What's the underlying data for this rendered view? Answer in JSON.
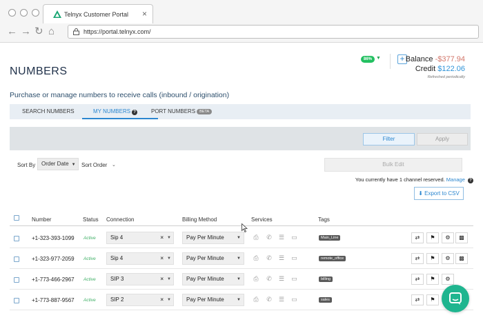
{
  "browser": {
    "tab_title": "Telnyx Customer Portal",
    "tab_close": "×",
    "url": "https://portal.telnyx.com/",
    "nav_icons": [
      "back-arrow-icon",
      "forward-arrow-icon",
      "reload-icon",
      "home-icon",
      "lock-icon"
    ]
  },
  "header": {
    "page_title": "NUMBERS",
    "percent_badge": "86%",
    "plus_label": "+",
    "balance_label": "Balance",
    "balance_value": "-$377.94",
    "credit_label": "Credit",
    "credit_value": "$122.06",
    "refreshed_note": "Refreshed periodically",
    "subtitle": "Purchase or manage numbers to receive calls (inbound / origination)"
  },
  "tabs": [
    {
      "label": "SEARCH NUMBERS",
      "active": false
    },
    {
      "label": "MY NUMBERS",
      "active": true,
      "help": "?"
    },
    {
      "label": "PORT NUMBERS",
      "active": false,
      "badge": "BETA"
    }
  ],
  "filter_panel": {
    "filter_label": "Filter",
    "apply_label": "Apply"
  },
  "controls": {
    "sort_by_label": "Sort By",
    "sort_by_value": "Order Date",
    "sort_order_label": "Sort Order",
    "bulk_edit_label": "Bulk Edit",
    "reserved_text": "You currently have 1 channel reserved.",
    "reserved_link": "Manage",
    "reserved_help": "?",
    "export_label": "Export to CSV"
  },
  "table": {
    "columns": [
      "Number",
      "Status",
      "Connection",
      "Billing Method",
      "Services",
      "Tags"
    ],
    "service_icons": [
      "fax-icon",
      "phone-icon",
      "database-icon",
      "id-card-icon"
    ],
    "action_icons": [
      "transfer-icon",
      "tag-icon",
      "gear-icon",
      "trash-icon"
    ],
    "rows": [
      {
        "number": "+1-323-393-1099",
        "status": "Active",
        "connection": "Sip 4",
        "billing": "Pay Per Minute",
        "tag": "Main_Line"
      },
      {
        "number": "+1-323-977-2059",
        "status": "Active",
        "connection": "Sip 4",
        "billing": "Pay Per Minute",
        "tag": "remote_office"
      },
      {
        "number": "+1-773-466-2967",
        "status": "Active",
        "connection": "SIP 3",
        "billing": "Pay Per Minute",
        "tag": "billing"
      },
      {
        "number": "+1-773-887-9567",
        "status": "Active",
        "connection": "SIP 2",
        "billing": "Pay Per Minute",
        "tag": "sales"
      }
    ]
  },
  "colors": {
    "accent": "#2b86cf",
    "active_green": "#3cae63",
    "balance_red": "#d2766a",
    "chat_green": "#1fb58f"
  }
}
